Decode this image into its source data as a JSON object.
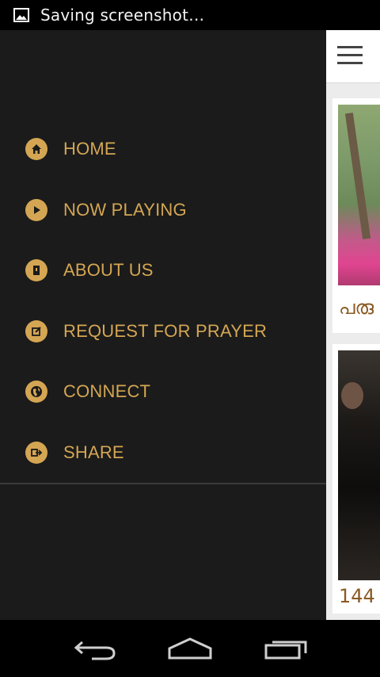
{
  "status_bar": {
    "text": "Saving screenshot…"
  },
  "drawer": {
    "items": [
      {
        "label": "HOME",
        "icon": "home-icon"
      },
      {
        "label": "NOW PLAYING",
        "icon": "play-icon"
      },
      {
        "label": "ABOUT US",
        "icon": "book-icon"
      },
      {
        "label": "REQUEST FOR PRAYER",
        "icon": "edit-icon"
      },
      {
        "label": "CONNECT",
        "icon": "globe-icon"
      },
      {
        "label": "SHARE",
        "icon": "share-icon"
      }
    ]
  },
  "content": {
    "cards": [
      {
        "title": "പരു"
      },
      {
        "title": "144"
      }
    ]
  },
  "colors": {
    "accent": "#d4a653",
    "drawer_bg": "#1b1b1b",
    "card_title": "#8a5a22"
  }
}
